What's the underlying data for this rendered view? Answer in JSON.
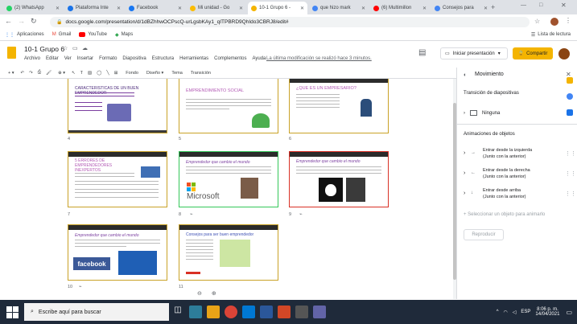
{
  "tabs": [
    {
      "label": "(2) WhatsApp",
      "color": "#25d366"
    },
    {
      "label": "Plataforma Inte",
      "color": "#1a73e8"
    },
    {
      "label": "Facebook",
      "color": "#1877f2"
    },
    {
      "label": "Mi unidad - Go",
      "color": "#fbbc04"
    },
    {
      "label": "10-1 Grupo 6 -",
      "color": "#f4b400"
    },
    {
      "label": "que hizo mark",
      "color": "#4285f4"
    },
    {
      "label": "(6) Multimillon",
      "color": "#ff0000"
    },
    {
      "label": "Consejos para",
      "color": "#4285f4"
    }
  ],
  "address": {
    "url": "docs.google.com/presentation/d/1dBZhhwOCPscQ-urLgsbKAy1_qITPBRD9QhIdo3CBRJ8/edit#"
  },
  "bookmarks": {
    "apps": "Aplicaciones",
    "gmail": "Gmail",
    "youtube": "YouTube",
    "maps": "Maps",
    "reading_list": "Lista de lectura"
  },
  "doc": {
    "title": "10-1 Grupo 6",
    "menu": [
      "Archivo",
      "Editar",
      "Ver",
      "Insertar",
      "Formato",
      "Diapositiva",
      "Estructura",
      "Herramientas",
      "Complementos",
      "Ayuda"
    ],
    "last_edit": "La última modificación se realizó hace 3 minutos.",
    "present": "Iniciar presentación",
    "share": "Compartir"
  },
  "toolbar": {
    "fondo": "Fondo",
    "diseno": "Diseño",
    "tema": "Tema",
    "transicion": "Transición"
  },
  "slides": [
    {
      "num": "4",
      "title": "CARACTERISTICAS DE UN BUEN EMPRENDEDOR"
    },
    {
      "num": "5",
      "title": "EMPRENDIMIENTO SOCIAL"
    },
    {
      "num": "6",
      "title": "¿QUE ES UN EMPRESARIO?"
    },
    {
      "num": "7",
      "title": "5 ERRORES DE EMPRENDEDORES INEXPERTOS"
    },
    {
      "num": "8",
      "title": "Emprendedor que cambio el mundo",
      "logo": "Microsoft"
    },
    {
      "num": "9",
      "title": "Emprendedor que cambio el mundo"
    },
    {
      "num": "10",
      "title": "Emprendedor que cambio el mundo",
      "logo": "facebook"
    },
    {
      "num": "11",
      "title": "Consejos para ser buen emprendedor"
    }
  ],
  "panel": {
    "title": "Movimiento",
    "transition_title": "Transición de diapositivas",
    "transition_value": "Ninguna",
    "animations_title": "Animaciones de objetos",
    "animations": [
      {
        "name": "Entrar desde la izquierda",
        "sub": "(Junto con la anterior)"
      },
      {
        "name": "Entrar desde la derecha",
        "sub": "(Junto con la anterior)"
      },
      {
        "name": "Entrar desde arriba",
        "sub": "(Junto con la anterior)"
      }
    ],
    "select_hint": "Seleccionar un objeto para animarlo",
    "play": "Reproducir"
  },
  "taskbar": {
    "search": "Escribe aquí para buscar",
    "time": "8:06 p. m.",
    "date": "14/04/2021",
    "lang": "ESP"
  }
}
